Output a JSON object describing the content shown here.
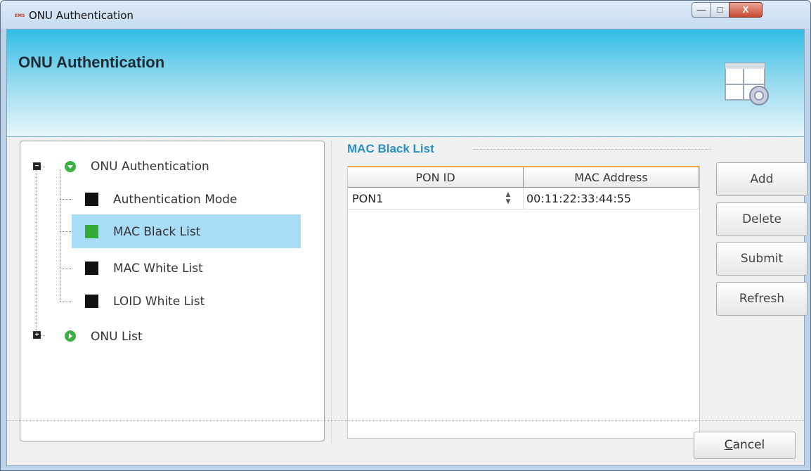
{
  "window": {
    "title": "ONU Authentication",
    "app_icon_text": "EMS",
    "controls": {
      "minimize": "—",
      "maximize": "□",
      "close": "X"
    }
  },
  "banner": {
    "title": "ONU Authentication",
    "icon": "window-settings-icon"
  },
  "tree": {
    "root": {
      "label": "ONU Authentication",
      "expander": "−",
      "icon": "green-down-arrow-icon"
    },
    "children": [
      {
        "label": "Authentication Mode",
        "color": "#111111"
      },
      {
        "label": "MAC Black List",
        "color": "#33aa33",
        "selected": true
      },
      {
        "label": "MAC White List",
        "color": "#111111"
      },
      {
        "label": "LOID White List",
        "color": "#111111"
      }
    ],
    "second_root": {
      "label": "ONU List",
      "expander": "+",
      "icon": "green-right-arrow-icon"
    }
  },
  "group": {
    "title": "MAC Black List"
  },
  "table": {
    "columns": [
      "PON ID",
      "MAC Address"
    ],
    "rows": [
      {
        "pon_id": "PON1",
        "mac": "00:11:22:33:44:55"
      }
    ]
  },
  "buttons": {
    "add": "Add",
    "delete": "Delete",
    "submit": "Submit",
    "refresh": "Refresh"
  },
  "footer": {
    "cancel_first": "C",
    "cancel_rest": "ancel"
  },
  "colors": {
    "accent": "#2a8fc4",
    "selected_row": "#a8dcf7",
    "green": "#3cb044"
  }
}
